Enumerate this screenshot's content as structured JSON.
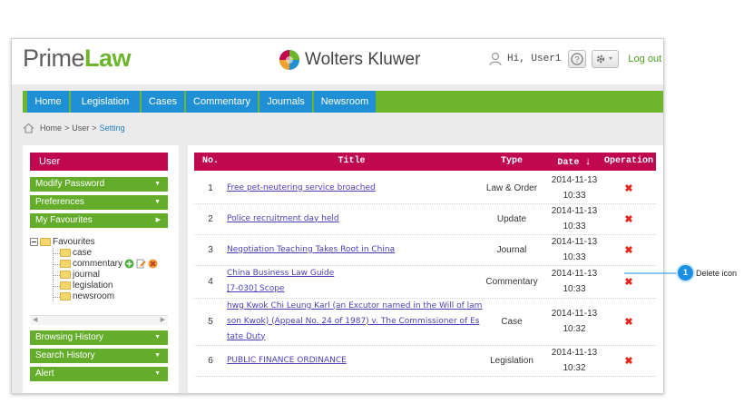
{
  "header": {
    "logo_part1": "Prime",
    "logo_part2": "Law",
    "brand": "Wolters Kluwer",
    "greeting": "Hi, User1",
    "help_label": "?",
    "logout": "Log out"
  },
  "nav": {
    "items": [
      "Home",
      "Legislation",
      "Cases",
      "Commentary",
      "Journals",
      "Newsroom"
    ]
  },
  "breadcrumb": {
    "home": "Home",
    "sep1": ">",
    "user": "User",
    "sep2": ">",
    "current": "Setting"
  },
  "sidebar": {
    "header": "User",
    "buttons": {
      "modify_password": "Modify Password",
      "preferences": "Preferences",
      "my_favourites": "My Favourites",
      "browsing_history": "Browsing History",
      "search_history": "Search History",
      "alert": "Alert"
    },
    "tree": {
      "root": "Favourites",
      "children": [
        "case",
        "commentary",
        "journal",
        "legislation",
        "newsroom"
      ]
    }
  },
  "table": {
    "columns": {
      "no": "No.",
      "title": "Title",
      "type": "Type",
      "date": "Date",
      "operation": "Operation"
    },
    "rows": [
      {
        "no": "1",
        "title_lines": [
          "Free pet-neutering service broached"
        ],
        "type": "Law & Order",
        "date": "2014-11-13",
        "time": "10:33"
      },
      {
        "no": "2",
        "title_lines": [
          "Police recruitment day held"
        ],
        "type": "Update",
        "date": "2014-11-13",
        "time": "10:33"
      },
      {
        "no": "3",
        "title_lines": [
          "Negotiation Teaching Takes Root in China"
        ],
        "type": "Journal",
        "date": "2014-11-13",
        "time": "10:33"
      },
      {
        "no": "4",
        "title_lines": [
          "China Business Law Guide",
          "[7-030] Scope"
        ],
        "type": "Commentary",
        "date": "2014-11-13",
        "time": "10:33"
      },
      {
        "no": "5",
        "title_lines": [
          "hwg Kwok Chi Leung Karl (an Excutor named in the Will of lam",
          "son Kwok) (Appeal No. 24 of 1987) v. The Commissioner of Es",
          "tate Duty"
        ],
        "type": "Case",
        "date": "2014-11-13",
        "time": "10:32"
      },
      {
        "no": "6",
        "title_lines": [
          "PUBLIC FINANCE ORDINANCE"
        ],
        "type": "Legislation",
        "date": "2014-11-13",
        "time": "10:32"
      }
    ],
    "delete_symbol": "✖"
  },
  "callout": {
    "number": "1",
    "label": "Delete icon"
  },
  "colors": {
    "green": "#6cb52d",
    "blue": "#1f90d5",
    "crimson": "#c0084f",
    "red_x": "#e3271c"
  }
}
